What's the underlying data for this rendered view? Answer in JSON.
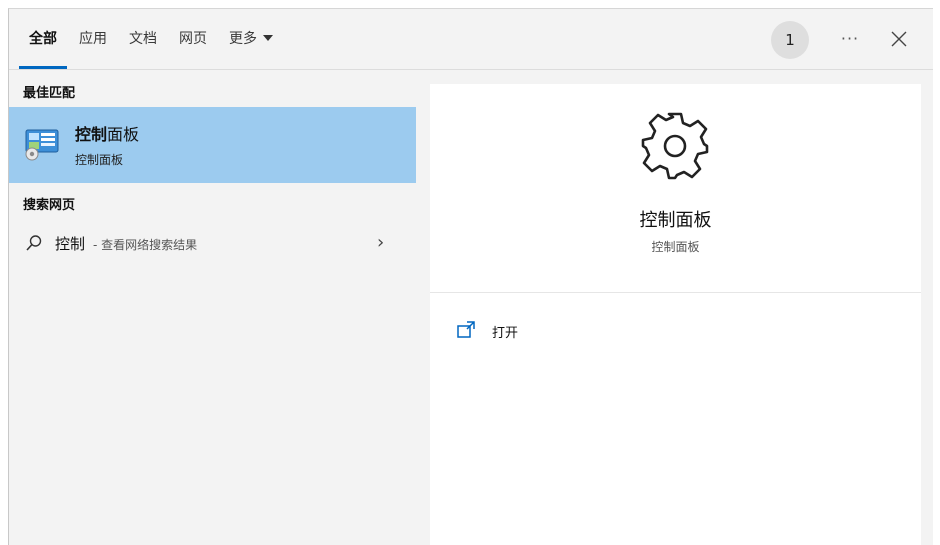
{
  "tabs": [
    {
      "label": "全部",
      "active": true
    },
    {
      "label": "应用"
    },
    {
      "label": "文档"
    },
    {
      "label": "网页"
    },
    {
      "label": "更多"
    }
  ],
  "header": {
    "badge_count": "1",
    "more_label": "···",
    "icons": {
      "more": "ellipsis-icon",
      "close": "close-icon"
    }
  },
  "best_match": {
    "section_title": "最佳匹配",
    "app": {
      "title_highlight": "控制",
      "title_rest": "面板",
      "subtitle": "控制面板",
      "icon": "control-panel-icon"
    },
    "highlight_color": "#9ccbef"
  },
  "web_search": {
    "section_title": "搜索网页",
    "term": "控制",
    "hint": "- 查看网络搜索结果",
    "chevron": "›",
    "icon": "search-icon"
  },
  "preview": {
    "icon": "gear-icon",
    "title": "控制面板",
    "subtitle": "控制面板",
    "actions": [
      {
        "label": "打开",
        "icon": "open-window-icon"
      }
    ]
  },
  "colors": {
    "accent": "#0067c0",
    "panel_bg": "#f3f3f3"
  }
}
